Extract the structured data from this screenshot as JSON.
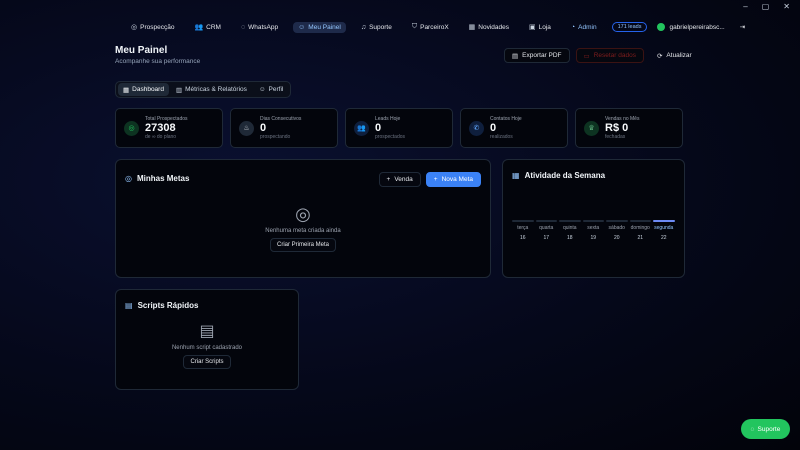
{
  "window": {
    "minimize": "–",
    "maximize": "▢",
    "close": "✕"
  },
  "nav": {
    "items": [
      {
        "label": "Prospecção",
        "icon": "target-icon",
        "glyph": "◎"
      },
      {
        "label": "CRM",
        "icon": "users-icon",
        "glyph": "👥"
      },
      {
        "label": "WhatsApp",
        "icon": "chat-icon",
        "glyph": "◌"
      },
      {
        "label": "Meu Painel",
        "icon": "user-icon",
        "glyph": "☺",
        "active": true
      },
      {
        "label": "Suporte",
        "icon": "headset-icon",
        "glyph": "♫"
      },
      {
        "label": "ParceiroX",
        "icon": "shield-icon",
        "glyph": "⛉"
      },
      {
        "label": "Novidades",
        "icon": "news-icon",
        "glyph": "▦"
      },
      {
        "label": "Loja",
        "icon": "store-icon",
        "glyph": "▣"
      }
    ],
    "admin_label": "Admin",
    "admin_glyph": "◔",
    "leads_badge": "171 leads",
    "user_email": "gabrielpereirabsc...",
    "logout_glyph": "⇥"
  },
  "header": {
    "title": "Meu Painel",
    "subtitle": "Acompanhe sua performance",
    "export_label": "Exportar PDF",
    "export_glyph": "▤",
    "reset_label": "Resetar dados",
    "reset_glyph": "▭",
    "refresh_label": "Atualizar",
    "refresh_glyph": "⟳"
  },
  "tabs": [
    {
      "label": "Dashboard",
      "glyph": "▦",
      "active": true
    },
    {
      "label": "Métricas & Relatórios",
      "glyph": "▥"
    },
    {
      "label": "Perfil",
      "glyph": "☺"
    }
  ],
  "stats": [
    {
      "label": "Total Prospectados",
      "value": "27308",
      "sub": "de ∞ do plano",
      "glyph": "◎",
      "color": "#22c55e",
      "bg": "#0d3321"
    },
    {
      "label": "Dias Consecutivos",
      "value": "0",
      "sub": "prospectando",
      "glyph": "♨",
      "color": "#d1d5db",
      "bg": "#1f2937"
    },
    {
      "label": "Leads Hoje",
      "value": "0",
      "sub": "prospectados",
      "glyph": "👥",
      "color": "#60a5fa",
      "bg": "#0f1f3d"
    },
    {
      "label": "Contatos Hoje",
      "value": "0",
      "sub": "realizados",
      "glyph": "✆",
      "color": "#60a5fa",
      "bg": "#0f1f3d"
    },
    {
      "label": "Vendas no Mês",
      "value": "R$ 0",
      "sub": "fechadas",
      "glyph": "♕",
      "color": "#86efac",
      "bg": "#0d3321"
    }
  ],
  "metas": {
    "title": "Minhas Metas",
    "title_glyph": "◎",
    "venda_label": "Venda",
    "nova_meta_label": "Nova Meta",
    "plus_glyph": "+",
    "empty_glyph": "◎",
    "empty_text": "Nenhuma meta criada ainda",
    "create_label": "Criar Primeira Meta"
  },
  "atividade": {
    "title": "Atividade da Semana",
    "title_glyph": "▦",
    "days": [
      {
        "name": "terça",
        "num": "16"
      },
      {
        "name": "quarta",
        "num": "17"
      },
      {
        "name": "quinta",
        "num": "18"
      },
      {
        "name": "sexta",
        "num": "19"
      },
      {
        "name": "sábado",
        "num": "20"
      },
      {
        "name": "domingo",
        "num": "21"
      },
      {
        "name": "segunda",
        "num": "22",
        "today": true
      }
    ]
  },
  "scripts": {
    "title": "Scripts Rápidos",
    "title_glyph": "▤",
    "empty_glyph": "▤",
    "empty_text": "Nenhum script cadastrado",
    "create_label": "Criar Scripts"
  },
  "fab": {
    "label": "Suporte",
    "glyph": "◌"
  }
}
